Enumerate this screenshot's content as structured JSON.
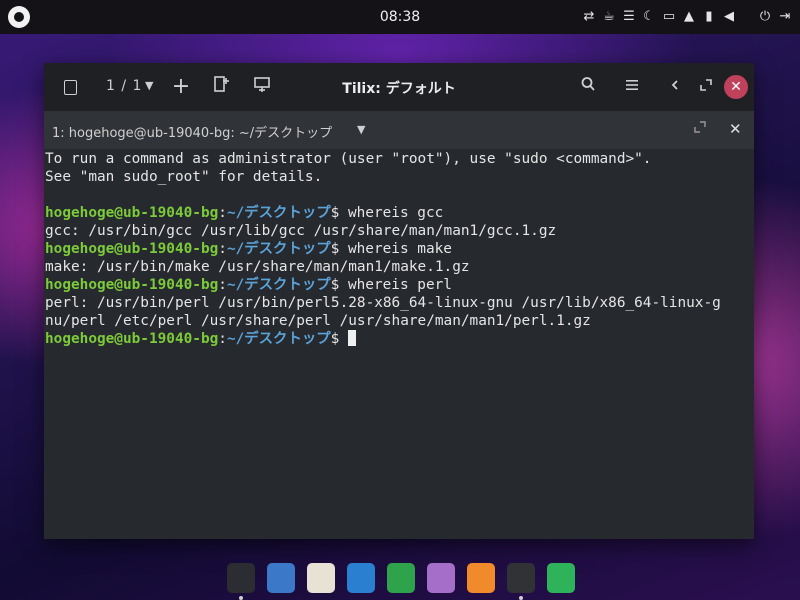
{
  "topbar": {
    "clock": "08:38",
    "tray_icons": [
      "network-icon",
      "coffee-icon",
      "menu-lines-icon",
      "night-light-icon",
      "files-icon",
      "notifications-icon",
      "battery-icon",
      "volume-icon",
      "power-icon",
      "logout-icon"
    ]
  },
  "window": {
    "title": "Tilix: デフォルト",
    "session_counter": "1 / 1",
    "add_label": "+",
    "minimize_label": "‹",
    "close_label": "✕"
  },
  "tab": {
    "title": "1: hogehoge@ub-19040-bg: ~/デスクトップ"
  },
  "terminal": {
    "prompt_user": "hogehoge@ub-19040-bg",
    "prompt_path": "~/デスクトップ",
    "lines": [
      {
        "type": "text",
        "text": "To run a command as administrator (user \"root\"), use \"sudo <command>\"."
      },
      {
        "type": "text",
        "text": "See \"man sudo_root\" for details."
      },
      {
        "type": "text",
        "text": ""
      },
      {
        "type": "prompt",
        "command": "whereis gcc"
      },
      {
        "type": "text",
        "text": "gcc: /usr/bin/gcc /usr/lib/gcc /usr/share/man/man1/gcc.1.gz"
      },
      {
        "type": "prompt",
        "command": "whereis make"
      },
      {
        "type": "text",
        "text": "make: /usr/bin/make /usr/share/man/man1/make.1.gz"
      },
      {
        "type": "prompt",
        "command": "whereis perl"
      },
      {
        "type": "text",
        "text": "perl: /usr/bin/perl /usr/bin/perl5.28-x86_64-linux-gnu /usr/lib/x86_64-linux-g"
      },
      {
        "type": "text",
        "text": "nu/perl /etc/perl /usr/share/perl /usr/share/man/man1/perl.1.gz"
      },
      {
        "type": "prompt",
        "command": "",
        "cursor": true
      }
    ]
  },
  "dock": {
    "items": [
      {
        "name": "ubuntu-budgie-icon",
        "color": "#2b2d33",
        "active": true
      },
      {
        "name": "app-grid-icon",
        "color": "#3c78c8",
        "active": false
      },
      {
        "name": "music-icon",
        "color": "#e8e2d4",
        "active": false
      },
      {
        "name": "writer-icon",
        "color": "#2a7fd0",
        "active": false
      },
      {
        "name": "calc-icon",
        "color": "#2ea34b",
        "active": false
      },
      {
        "name": "folder-icon",
        "color": "#a46ec9",
        "active": false
      },
      {
        "name": "firefox-icon",
        "color": "#f08a2b",
        "active": false
      },
      {
        "name": "terminal-icon",
        "color": "#303236",
        "active": true
      },
      {
        "name": "update-icon",
        "color": "#2fb35a",
        "active": false
      }
    ]
  }
}
